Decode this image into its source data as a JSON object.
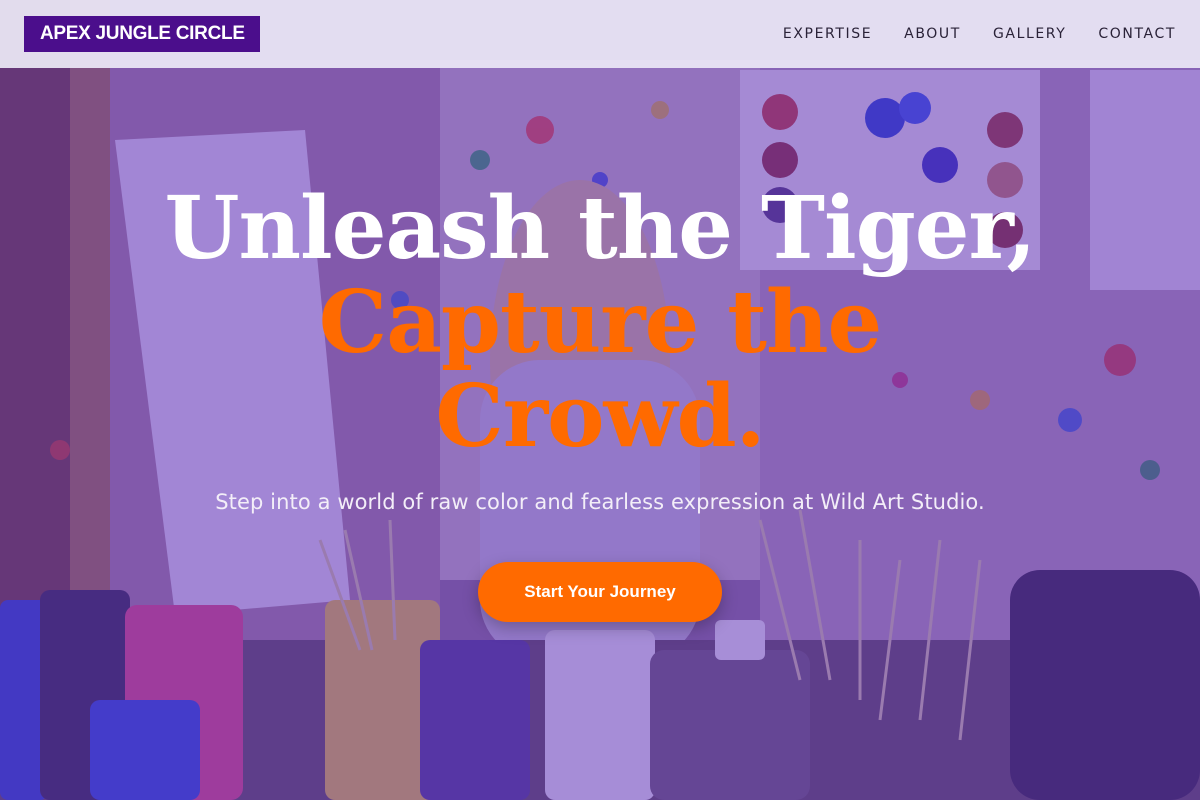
{
  "brand": {
    "logo_text": "APEX JUNGLE CIRCLE"
  },
  "nav": {
    "items": [
      {
        "label": "EXPERTISE"
      },
      {
        "label": "ABOUT"
      },
      {
        "label": "GALLERY"
      },
      {
        "label": "CONTACT"
      }
    ]
  },
  "hero": {
    "headline_line1": "Unleash the Tiger,",
    "headline_line2": "Capture the",
    "headline_line3": "Crowd.",
    "subtitle": "Step into a world of raw color and fearless expression at Wild Art Studio.",
    "cta_label": "Start Your Journey",
    "background": "painting-studio-photo"
  },
  "colors": {
    "accent": "#ff6a00",
    "brand": "#4b0e8c",
    "overlay": "#6234be"
  }
}
